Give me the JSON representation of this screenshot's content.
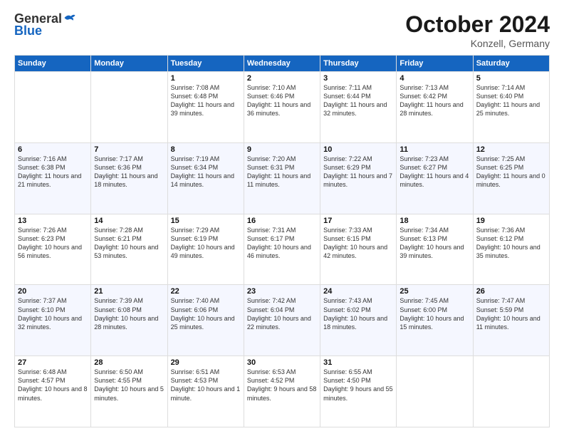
{
  "header": {
    "logo_general": "General",
    "logo_blue": "Blue",
    "month_title": "October 2024",
    "location": "Konzell, Germany"
  },
  "days_of_week": [
    "Sunday",
    "Monday",
    "Tuesday",
    "Wednesday",
    "Thursday",
    "Friday",
    "Saturday"
  ],
  "weeks": [
    [
      {
        "day": "",
        "sunrise": "",
        "sunset": "",
        "daylight": ""
      },
      {
        "day": "",
        "sunrise": "",
        "sunset": "",
        "daylight": ""
      },
      {
        "day": "1",
        "sunrise": "Sunrise: 7:08 AM",
        "sunset": "Sunset: 6:48 PM",
        "daylight": "Daylight: 11 hours and 39 minutes."
      },
      {
        "day": "2",
        "sunrise": "Sunrise: 7:10 AM",
        "sunset": "Sunset: 6:46 PM",
        "daylight": "Daylight: 11 hours and 36 minutes."
      },
      {
        "day": "3",
        "sunrise": "Sunrise: 7:11 AM",
        "sunset": "Sunset: 6:44 PM",
        "daylight": "Daylight: 11 hours and 32 minutes."
      },
      {
        "day": "4",
        "sunrise": "Sunrise: 7:13 AM",
        "sunset": "Sunset: 6:42 PM",
        "daylight": "Daylight: 11 hours and 28 minutes."
      },
      {
        "day": "5",
        "sunrise": "Sunrise: 7:14 AM",
        "sunset": "Sunset: 6:40 PM",
        "daylight": "Daylight: 11 hours and 25 minutes."
      }
    ],
    [
      {
        "day": "6",
        "sunrise": "Sunrise: 7:16 AM",
        "sunset": "Sunset: 6:38 PM",
        "daylight": "Daylight: 11 hours and 21 minutes."
      },
      {
        "day": "7",
        "sunrise": "Sunrise: 7:17 AM",
        "sunset": "Sunset: 6:36 PM",
        "daylight": "Daylight: 11 hours and 18 minutes."
      },
      {
        "day": "8",
        "sunrise": "Sunrise: 7:19 AM",
        "sunset": "Sunset: 6:34 PM",
        "daylight": "Daylight: 11 hours and 14 minutes."
      },
      {
        "day": "9",
        "sunrise": "Sunrise: 7:20 AM",
        "sunset": "Sunset: 6:31 PM",
        "daylight": "Daylight: 11 hours and 11 minutes."
      },
      {
        "day": "10",
        "sunrise": "Sunrise: 7:22 AM",
        "sunset": "Sunset: 6:29 PM",
        "daylight": "Daylight: 11 hours and 7 minutes."
      },
      {
        "day": "11",
        "sunrise": "Sunrise: 7:23 AM",
        "sunset": "Sunset: 6:27 PM",
        "daylight": "Daylight: 11 hours and 4 minutes."
      },
      {
        "day": "12",
        "sunrise": "Sunrise: 7:25 AM",
        "sunset": "Sunset: 6:25 PM",
        "daylight": "Daylight: 11 hours and 0 minutes."
      }
    ],
    [
      {
        "day": "13",
        "sunrise": "Sunrise: 7:26 AM",
        "sunset": "Sunset: 6:23 PM",
        "daylight": "Daylight: 10 hours and 56 minutes."
      },
      {
        "day": "14",
        "sunrise": "Sunrise: 7:28 AM",
        "sunset": "Sunset: 6:21 PM",
        "daylight": "Daylight: 10 hours and 53 minutes."
      },
      {
        "day": "15",
        "sunrise": "Sunrise: 7:29 AM",
        "sunset": "Sunset: 6:19 PM",
        "daylight": "Daylight: 10 hours and 49 minutes."
      },
      {
        "day": "16",
        "sunrise": "Sunrise: 7:31 AM",
        "sunset": "Sunset: 6:17 PM",
        "daylight": "Daylight: 10 hours and 46 minutes."
      },
      {
        "day": "17",
        "sunrise": "Sunrise: 7:33 AM",
        "sunset": "Sunset: 6:15 PM",
        "daylight": "Daylight: 10 hours and 42 minutes."
      },
      {
        "day": "18",
        "sunrise": "Sunrise: 7:34 AM",
        "sunset": "Sunset: 6:13 PM",
        "daylight": "Daylight: 10 hours and 39 minutes."
      },
      {
        "day": "19",
        "sunrise": "Sunrise: 7:36 AM",
        "sunset": "Sunset: 6:12 PM",
        "daylight": "Daylight: 10 hours and 35 minutes."
      }
    ],
    [
      {
        "day": "20",
        "sunrise": "Sunrise: 7:37 AM",
        "sunset": "Sunset: 6:10 PM",
        "daylight": "Daylight: 10 hours and 32 minutes."
      },
      {
        "day": "21",
        "sunrise": "Sunrise: 7:39 AM",
        "sunset": "Sunset: 6:08 PM",
        "daylight": "Daylight: 10 hours and 28 minutes."
      },
      {
        "day": "22",
        "sunrise": "Sunrise: 7:40 AM",
        "sunset": "Sunset: 6:06 PM",
        "daylight": "Daylight: 10 hours and 25 minutes."
      },
      {
        "day": "23",
        "sunrise": "Sunrise: 7:42 AM",
        "sunset": "Sunset: 6:04 PM",
        "daylight": "Daylight: 10 hours and 22 minutes."
      },
      {
        "day": "24",
        "sunrise": "Sunrise: 7:43 AM",
        "sunset": "Sunset: 6:02 PM",
        "daylight": "Daylight: 10 hours and 18 minutes."
      },
      {
        "day": "25",
        "sunrise": "Sunrise: 7:45 AM",
        "sunset": "Sunset: 6:00 PM",
        "daylight": "Daylight: 10 hours and 15 minutes."
      },
      {
        "day": "26",
        "sunrise": "Sunrise: 7:47 AM",
        "sunset": "Sunset: 5:59 PM",
        "daylight": "Daylight: 10 hours and 11 minutes."
      }
    ],
    [
      {
        "day": "27",
        "sunrise": "Sunrise: 6:48 AM",
        "sunset": "Sunset: 4:57 PM",
        "daylight": "Daylight: 10 hours and 8 minutes."
      },
      {
        "day": "28",
        "sunrise": "Sunrise: 6:50 AM",
        "sunset": "Sunset: 4:55 PM",
        "daylight": "Daylight: 10 hours and 5 minutes."
      },
      {
        "day": "29",
        "sunrise": "Sunrise: 6:51 AM",
        "sunset": "Sunset: 4:53 PM",
        "daylight": "Daylight: 10 hours and 1 minute."
      },
      {
        "day": "30",
        "sunrise": "Sunrise: 6:53 AM",
        "sunset": "Sunset: 4:52 PM",
        "daylight": "Daylight: 9 hours and 58 minutes."
      },
      {
        "day": "31",
        "sunrise": "Sunrise: 6:55 AM",
        "sunset": "Sunset: 4:50 PM",
        "daylight": "Daylight: 9 hours and 55 minutes."
      },
      {
        "day": "",
        "sunrise": "",
        "sunset": "",
        "daylight": ""
      },
      {
        "day": "",
        "sunrise": "",
        "sunset": "",
        "daylight": ""
      }
    ]
  ]
}
